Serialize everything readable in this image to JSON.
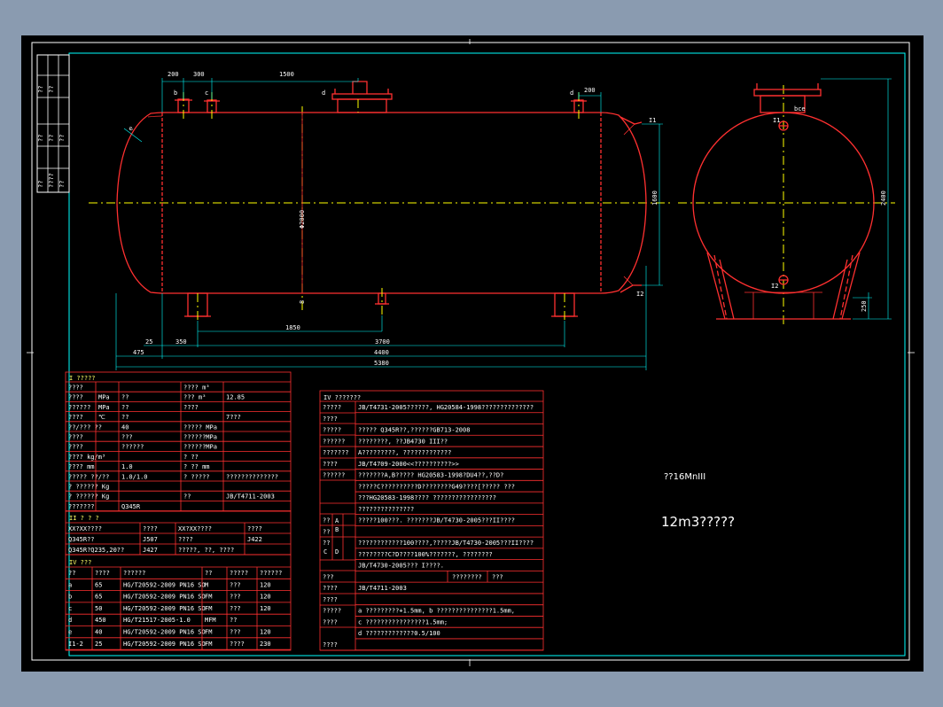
{
  "left_strip": [
    "??",
    "??",
    "??",
    "??",
    "??",
    "??",
    "????",
    "??"
  ],
  "dims": {
    "top": [
      "200",
      "300",
      "1500",
      "200"
    ],
    "bottom": [
      "25",
      "350",
      "1850",
      "3700",
      "475",
      "4400",
      "5380"
    ],
    "vertical": [
      "1600",
      "2400",
      "250",
      "Φ2000"
    ]
  },
  "nozzles": {
    "labels": [
      "b",
      "c",
      "d",
      "d",
      "e",
      "I1",
      "I2",
      "I1",
      "I2",
      "bce"
    ]
  },
  "table_design": {
    "title": "I ?????",
    "rows": [
      [
        "????",
        "",
        "",
        "???? m³",
        ""
      ],
      [
        "????",
        "MPa",
        "??",
        "???  m³",
        "12.85"
      ],
      [
        "??????",
        "MPa",
        "??",
        "????",
        ""
      ],
      [
        "????",
        "℃",
        "??",
        "",
        "7???"
      ],
      [
        "??/???  ??",
        "",
        "40",
        "????? MPa",
        ""
      ],
      [
        "????",
        "",
        "???",
        "??????MPa",
        ""
      ],
      [
        "????",
        "",
        "??????",
        "??????MPa",
        ""
      ],
      [
        "????  kg/m³",
        "",
        "",
        "?  ??",
        ""
      ],
      [
        "????   mm",
        "",
        "1.0",
        "?  ??   mm",
        ""
      ],
      [
        "?????  ??/??",
        "",
        "1.0/1.0",
        "?  ?????",
        "??????????????"
      ],
      [
        "? ??????  Kg",
        "",
        "",
        "",
        ""
      ],
      [
        "? ??????  Kg",
        "",
        "",
        "??",
        "JB/T4711-2003"
      ],
      [
        "???????",
        "",
        "Q345R",
        "",
        ""
      ]
    ]
  },
  "table_material": {
    "title": "II ? ? ?",
    "rows": [
      [
        "XX?XX????",
        "????",
        "XX?XX????",
        "????"
      ],
      [
        "Q345R??",
        "J507",
        "????",
        "J422"
      ],
      [
        "Q345R?Q235,20??",
        "J427",
        "?????, ??, ????",
        ""
      ]
    ]
  },
  "table_nozzle": {
    "title": "IV ???",
    "header": [
      "??",
      "????",
      "??????",
      "??",
      "?????",
      "??????"
    ],
    "rows": [
      [
        "a",
        "65",
        "HG/T20592-2009 PN16 SO",
        "M",
        "???",
        "120"
      ],
      [
        "b",
        "65",
        "HG/T20592-2009 PN16 SO",
        "FM",
        "???",
        "120"
      ],
      [
        "c",
        "50",
        "HG/T20592-2009 PN16 SO",
        "FM",
        "???",
        "120"
      ],
      [
        "d",
        "450",
        "HG/T21517-2005-1.0",
        "MFM",
        "??",
        ""
      ],
      [
        "e",
        "40",
        "HG/T20592-2009 PN16 SO",
        "FM",
        "???",
        "120"
      ],
      [
        "I1-2",
        "25",
        "HG/T20592-2009 PN16 SO",
        "FM",
        "????",
        "230"
      ]
    ]
  },
  "table_tech": {
    "title": "IV ???????",
    "rows": [
      [
        "?????",
        "JB/T4731-2005??????, HG20584-1998??????????????"
      ],
      [
        "????",
        ""
      ],
      [
        "?????",
        "?????  Q345R??,??????GB713-2008"
      ],
      [
        "??????",
        "????????, ??JB4730 III??"
      ],
      [
        "???????",
        "A?????????, ?????????????"
      ],
      [
        "????",
        "JB/T4709-2000<<??????????>>"
      ],
      [
        "??????",
        "???????A,B????? HG20583-1998?DU4??,??D?"
      ],
      [
        "",
        "?????C??????????D????????G49????[?????     ???"
      ],
      [
        "",
        "???HG20583-1998????  ?????????????????"
      ],
      [
        "",
        "???????????????"
      ],
      [
        "??",
        "?????100???.  ???????JB/T4730-2005???II????"
      ],
      [
        "??",
        ""
      ],
      [
        "??",
        "????????????100????,?????JB/T4730-2005???II????"
      ],
      [
        "",
        "????????C?D????100%???????,     ????????"
      ],
      [
        "",
        "JB/T4730-2005??? I????."
      ],
      [
        "???",
        "",
        "????????",
        "???"
      ],
      [
        "????",
        "JB/T4711-2003"
      ],
      [
        "????",
        ""
      ],
      [
        "?????",
        "a ?????????+1.5mm, b ???????????????1.5mm,"
      ],
      [
        "????",
        "c ????????????????1.5mm;"
      ],
      [
        "",
        "d ?????????????0.5/100"
      ],
      [
        "????",
        ""
      ]
    ],
    "ab": [
      "A",
      "B"
    ],
    "cd": [
      "C",
      "D"
    ]
  },
  "notes": {
    "material_note": "??16MnIII",
    "capacity_title": "12m3?????"
  }
}
